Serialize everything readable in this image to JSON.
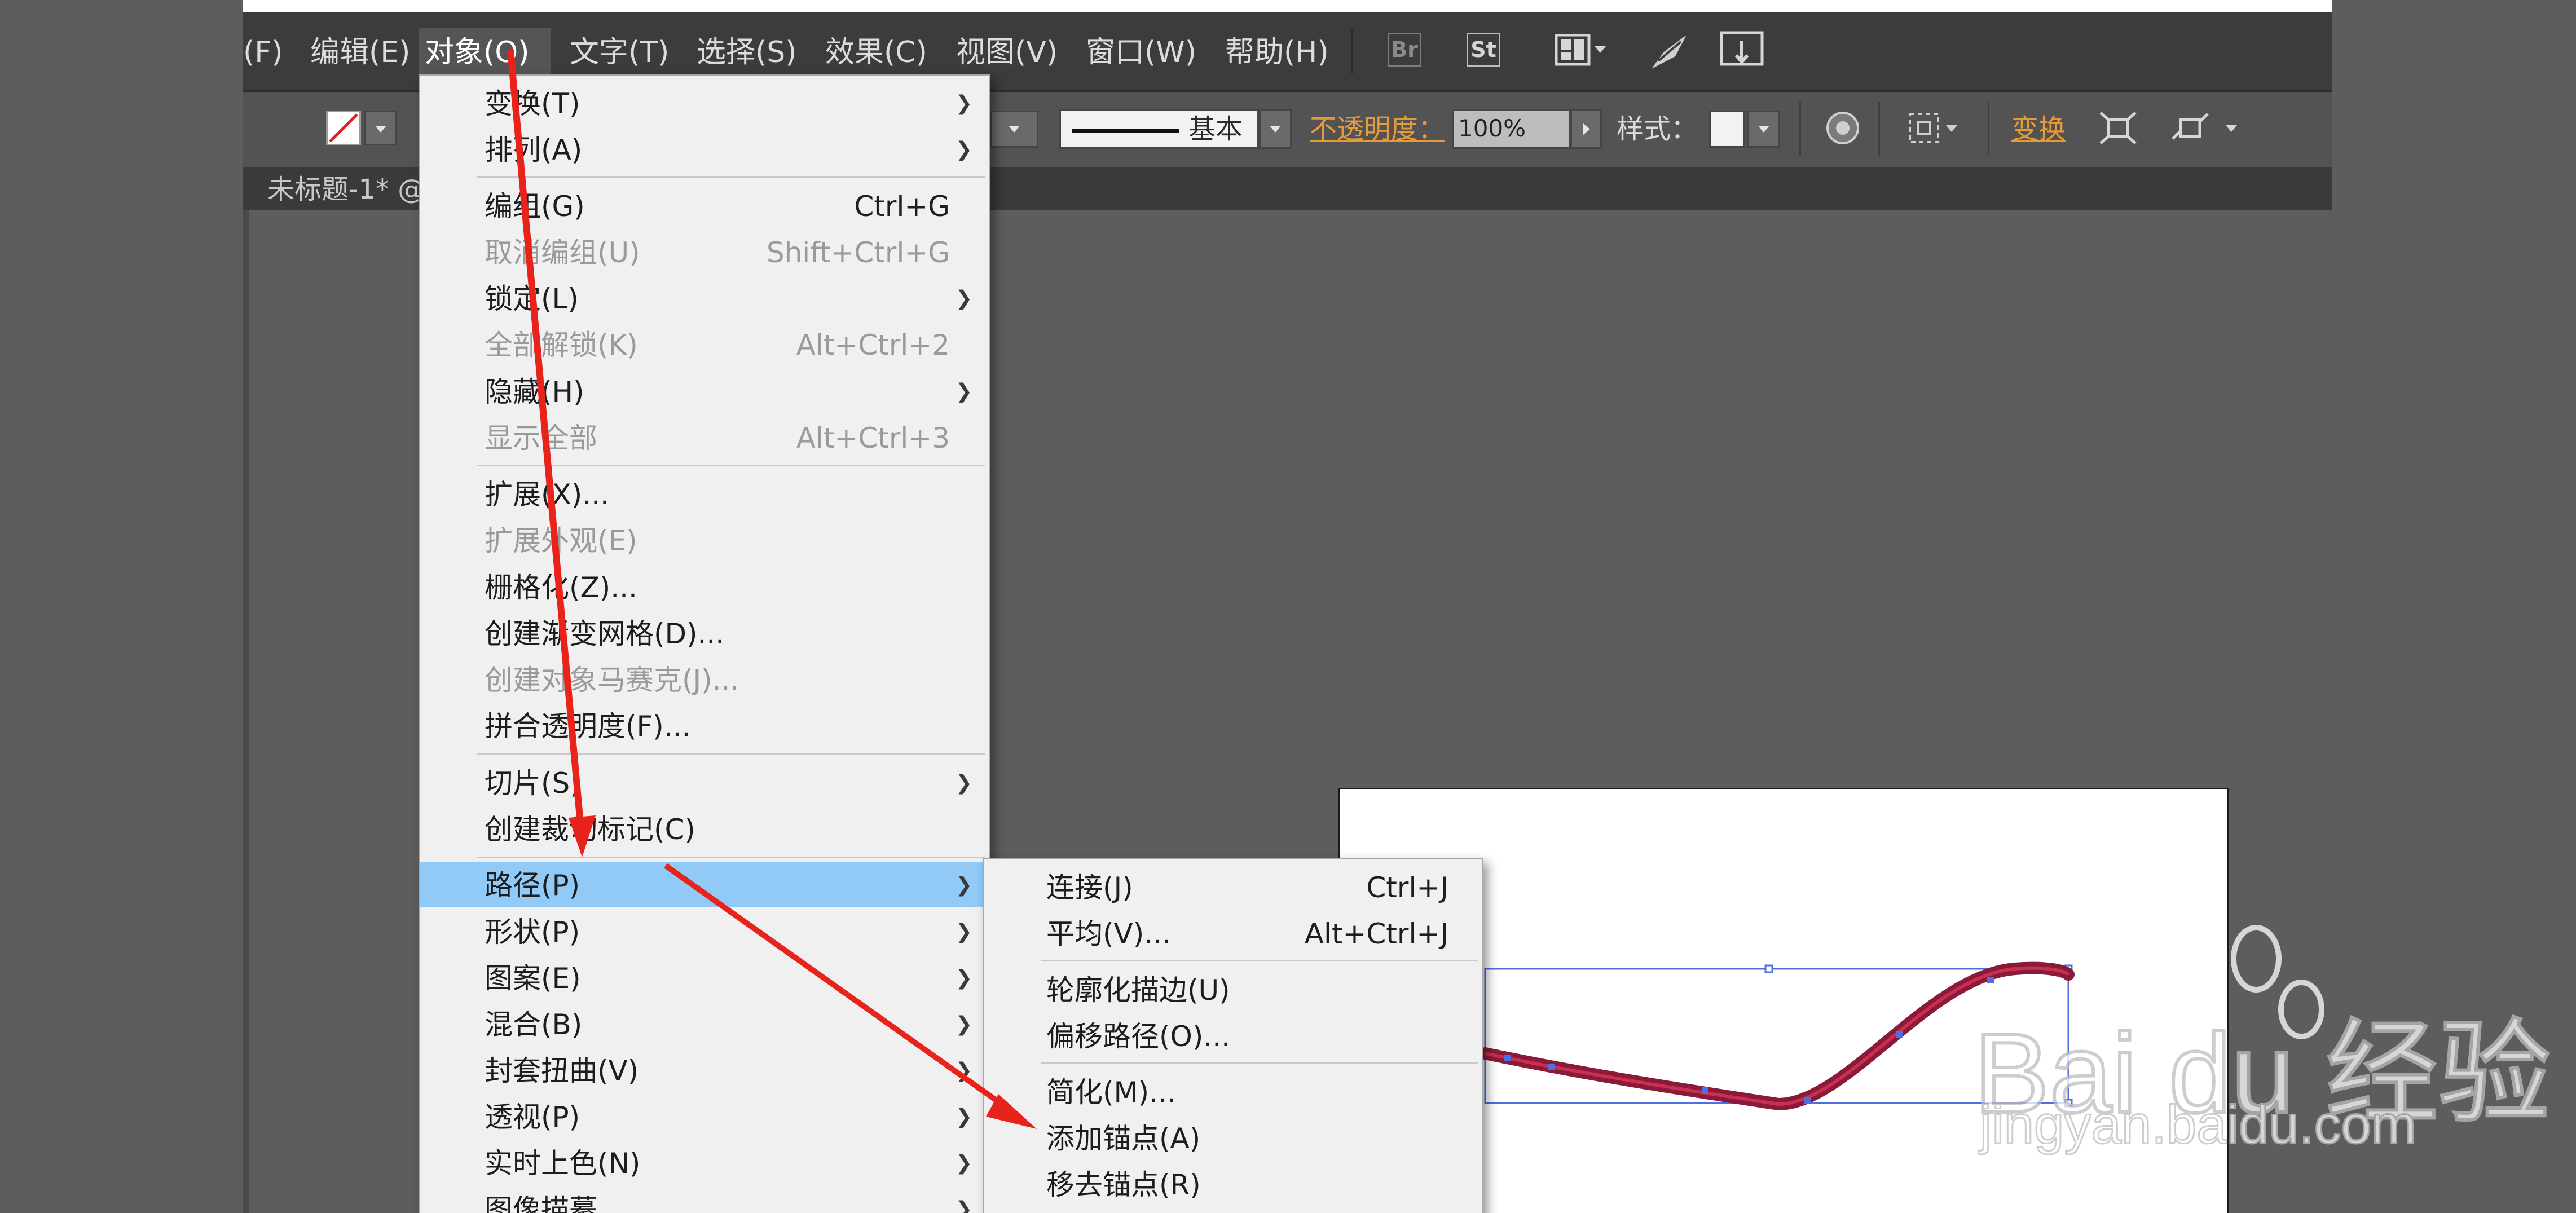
{
  "menubar": {
    "items": [
      {
        "label": "(F)"
      },
      {
        "label": "编辑(E)"
      },
      {
        "label": "对象(O)"
      },
      {
        "label": "文字(T)"
      },
      {
        "label": "选择(S)"
      },
      {
        "label": "效果(C)"
      },
      {
        "label": "视图(V)"
      },
      {
        "label": "窗口(W)"
      },
      {
        "label": "帮助(H)"
      }
    ],
    "br_label": "Br",
    "st_label": "St"
  },
  "toolbar": {
    "stroke_style": "基本",
    "opacity_label": "不透明度：",
    "opacity_value": "100%",
    "style_label": "样式：",
    "transform_label": "变换"
  },
  "document": {
    "tab_title": "未标题-1* @"
  },
  "object_menu": {
    "items": [
      {
        "label": "变换(T)",
        "shortcut": "",
        "submenu": true,
        "disabled": false
      },
      {
        "label": "排列(A)",
        "shortcut": "",
        "submenu": true,
        "disabled": false
      },
      {
        "label": "编组(G)",
        "shortcut": "Ctrl+G",
        "submenu": false,
        "disabled": false
      },
      {
        "label": "取消编组(U)",
        "shortcut": "Shift+Ctrl+G",
        "submenu": false,
        "disabled": true
      },
      {
        "label": "锁定(L)",
        "shortcut": "",
        "submenu": true,
        "disabled": false
      },
      {
        "label": "全部解锁(K)",
        "shortcut": "Alt+Ctrl+2",
        "submenu": false,
        "disabled": true
      },
      {
        "label": "隐藏(H)",
        "shortcut": "",
        "submenu": true,
        "disabled": false
      },
      {
        "label": "显示全部",
        "shortcut": "Alt+Ctrl+3",
        "submenu": false,
        "disabled": true
      },
      {
        "label": "扩展(X)...",
        "shortcut": "",
        "submenu": false,
        "disabled": false
      },
      {
        "label": "扩展外观(E)",
        "shortcut": "",
        "submenu": false,
        "disabled": true
      },
      {
        "label": "栅格化(Z)...",
        "shortcut": "",
        "submenu": false,
        "disabled": false
      },
      {
        "label": "创建渐变网格(D)...",
        "shortcut": "",
        "submenu": false,
        "disabled": false
      },
      {
        "label": "创建对象马赛克(J)...",
        "shortcut": "",
        "submenu": false,
        "disabled": true
      },
      {
        "label": "拼合透明度(F)...",
        "shortcut": "",
        "submenu": false,
        "disabled": false
      },
      {
        "label": "切片(S)",
        "shortcut": "",
        "submenu": true,
        "disabled": false
      },
      {
        "label": "创建裁切标记(C)",
        "shortcut": "",
        "submenu": false,
        "disabled": false
      },
      {
        "label": "路径(P)",
        "shortcut": "",
        "submenu": true,
        "disabled": false,
        "highlighted": true
      },
      {
        "label": "形状(P)",
        "shortcut": "",
        "submenu": true,
        "disabled": false
      },
      {
        "label": "图案(E)",
        "shortcut": "",
        "submenu": true,
        "disabled": false
      },
      {
        "label": "混合(B)",
        "shortcut": "",
        "submenu": true,
        "disabled": false
      },
      {
        "label": "封套扭曲(V)",
        "shortcut": "",
        "submenu": true,
        "disabled": false
      },
      {
        "label": "透视(P)",
        "shortcut": "",
        "submenu": true,
        "disabled": false
      },
      {
        "label": "实时上色(N)",
        "shortcut": "",
        "submenu": true,
        "disabled": false
      },
      {
        "label": "图像描摹",
        "shortcut": "",
        "submenu": true,
        "disabled": false
      }
    ]
  },
  "path_submenu": {
    "items": [
      {
        "label": "连接(J)",
        "shortcut": "Ctrl+J"
      },
      {
        "label": "平均(V)...",
        "shortcut": "Alt+Ctrl+J"
      },
      {
        "label": "轮廓化描边(U)",
        "shortcut": ""
      },
      {
        "label": "偏移路径(O)...",
        "shortcut": ""
      },
      {
        "label": "简化(M)...",
        "shortcut": ""
      },
      {
        "label": "添加锚点(A)",
        "shortcut": ""
      },
      {
        "label": "移去锚点(R)",
        "shortcut": ""
      }
    ]
  },
  "watermark": {
    "brand": "Bai du 经验",
    "url": "jingyan.baidu.com"
  },
  "colors": {
    "accent_highlight": "#91c9f7",
    "annotation_arrow": "#e8231c",
    "path_stroke": "#8b1a3a",
    "selection_blue": "#4f6fe0"
  }
}
